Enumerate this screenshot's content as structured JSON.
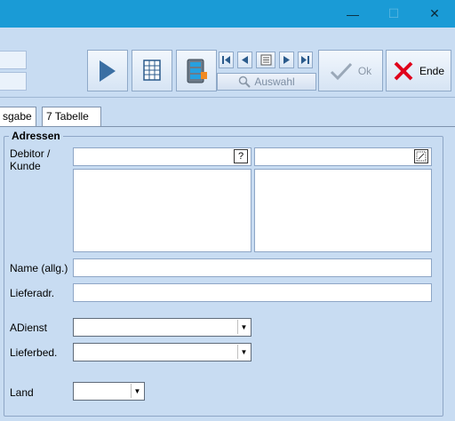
{
  "window": {
    "minimize_icon": "minimize-icon",
    "maximize_icon": "maximize-icon",
    "close_icon": "close-icon",
    "minimize_glyph": "—",
    "maximize_glyph": "☐",
    "close_glyph": "✕"
  },
  "toolbar": {
    "auswahl_label": "Auswahl",
    "ok_label": "Ok",
    "ende_label": "Ende"
  },
  "tabs": [
    {
      "label": "sgabe"
    },
    {
      "label": "7 Tabelle"
    }
  ],
  "group": {
    "title": "Adressen"
  },
  "form": {
    "debitor_label_1": "Debitor /",
    "debitor_label_2": "Kunde",
    "question_mark": "?",
    "name_label": "Name (allg.)",
    "lieferadr_label": "Lieferadr.",
    "adienst_label": "ADienst",
    "lieferbed_label": "Lieferbed.",
    "land_label": "Land",
    "name_value": "",
    "lieferadr_value": "",
    "adienst_value": "",
    "lieferbed_value": "",
    "land_value": ""
  },
  "colors": {
    "titlebar": "#1a9bd6",
    "background": "#c8dcf2",
    "ende_x": "#e0001b"
  }
}
